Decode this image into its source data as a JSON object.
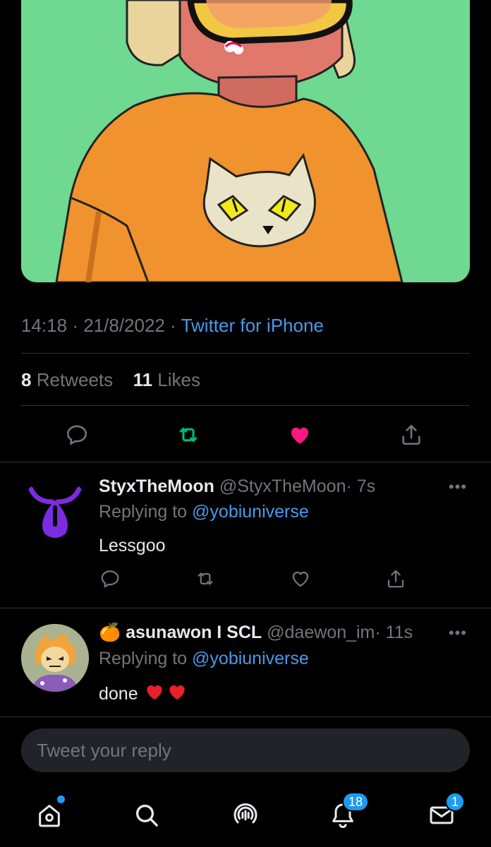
{
  "tweet": {
    "time": "14:18",
    "sep1": "·",
    "date": "21/8/2022",
    "sep2": "·",
    "source": "Twitter for iPhone",
    "retweets_count": "8",
    "retweets_label": "Retweets",
    "likes_count": "11",
    "likes_label": "Likes",
    "liked": true,
    "retweeted": true
  },
  "replies": [
    {
      "name": "StyxTheMoon",
      "handle": "@StyxTheMoon",
      "time": "· 7s",
      "replying_prefix": "Replying to",
      "replying_to": "@yobiuniverse",
      "text": "Lessgoo",
      "more": "•••"
    },
    {
      "name_emoji": "🍊",
      "name": "asunawon I SCL",
      "handle": "@daewon_im",
      "time": "· 11s",
      "replying_prefix": "Replying to",
      "replying_to": "@yobiuniverse",
      "text": "done",
      "more": "•••"
    }
  ],
  "composer": {
    "placeholder": "Tweet your reply"
  },
  "tabbar": {
    "notifications_badge": "18",
    "messages_badge": "1"
  },
  "colors": {
    "accent": "#1d9bf0",
    "link": "#4a99e9",
    "like": "#f91880",
    "retweet": "#00ba7c",
    "muted": "#71767b",
    "art_bg": "#6fd891"
  },
  "icons": {
    "reply": "reply-icon",
    "retweet": "retweet-icon",
    "like": "heart-icon",
    "share": "share-icon",
    "home": "home-icon",
    "search": "search-icon",
    "spaces": "spaces-icon",
    "notifications": "bell-icon",
    "messages": "mail-icon"
  }
}
